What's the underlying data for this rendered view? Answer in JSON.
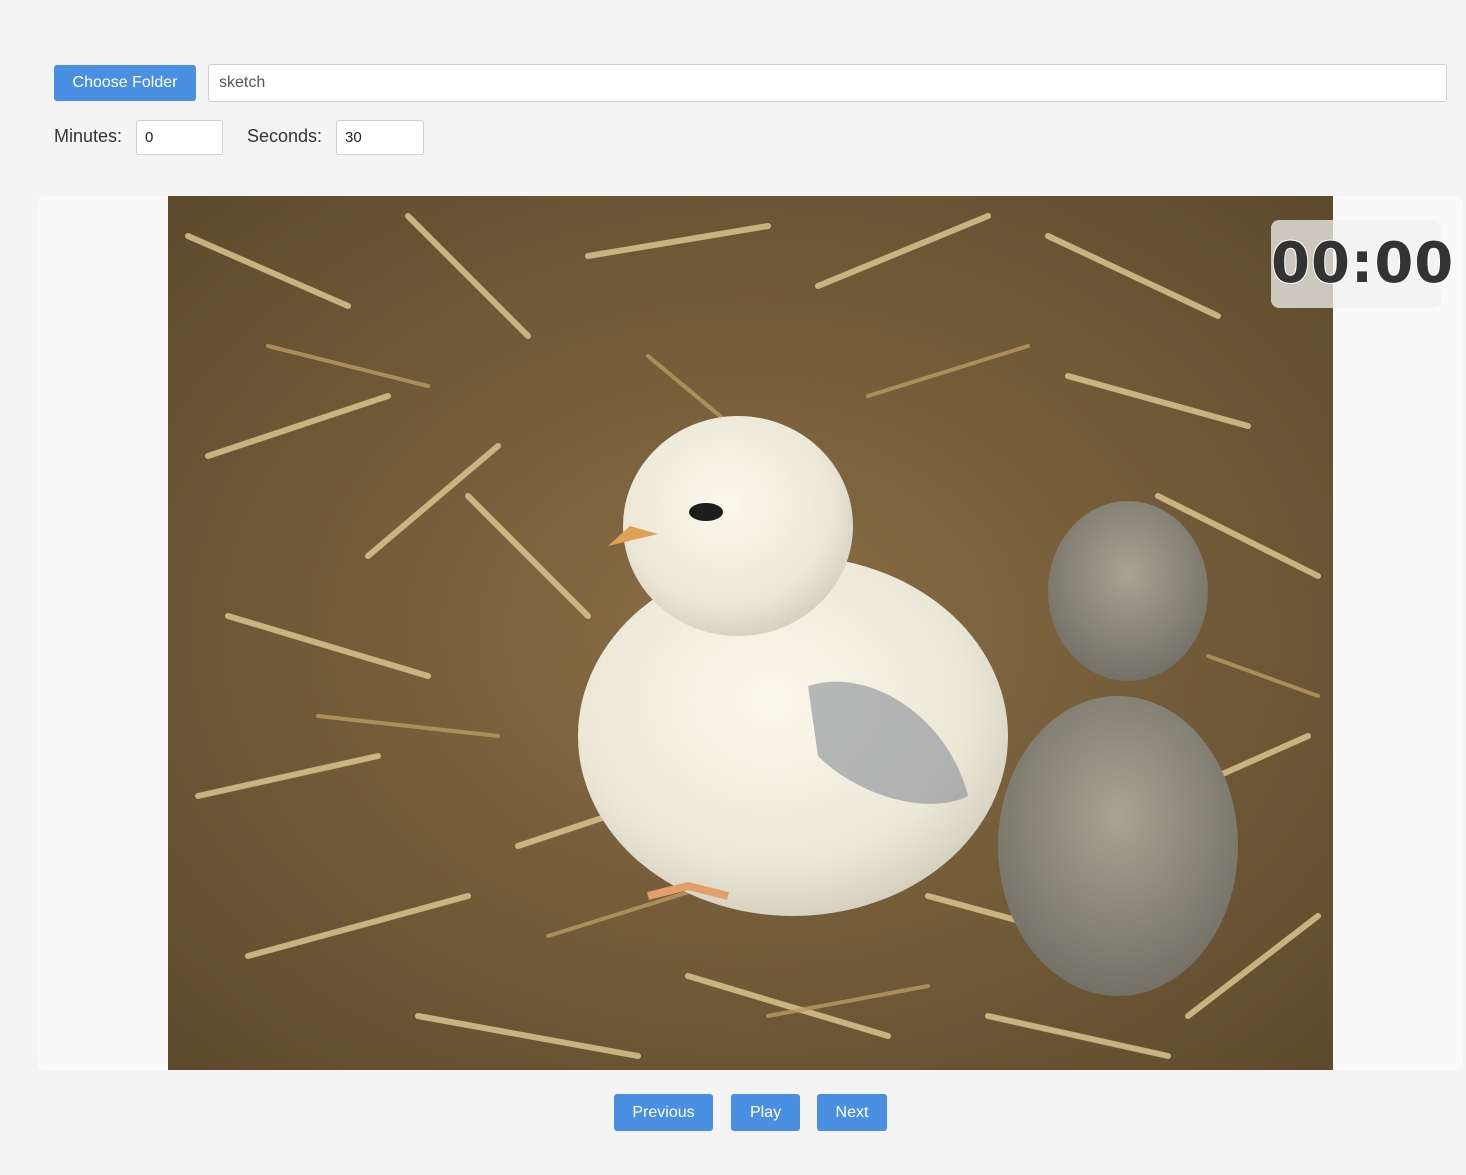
{
  "folder": {
    "button_label": "Choose Folder",
    "path_value": "sketch"
  },
  "timer_settings": {
    "minutes_label": "Minutes:",
    "minutes_value": "0",
    "seconds_label": "Seconds:",
    "seconds_value": "30"
  },
  "viewer": {
    "image_subject": "two fluffy chicks sitting on straw",
    "countdown": "00:00"
  },
  "controls": {
    "previous_label": "Previous",
    "play_label": "Play",
    "next_label": "Next"
  },
  "colors": {
    "accent": "#4a90e2",
    "background": "#f4f4f4"
  }
}
